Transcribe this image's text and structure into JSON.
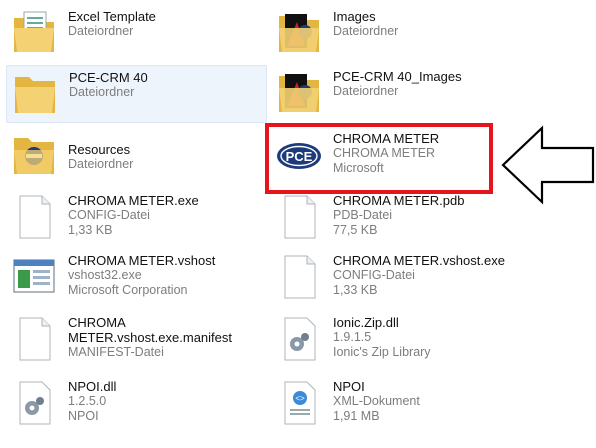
{
  "items": [
    {
      "name": "Excel Template",
      "lines": [
        "Dateiordner"
      ],
      "icon": "folder-excel-icon"
    },
    {
      "name": "Images",
      "lines": [
        "Dateiordner"
      ],
      "icon": "folder-images-icon"
    },
    {
      "name": "PCE-CRM 40",
      "lines": [
        "Dateiordner"
      ],
      "icon": "folder-icon"
    },
    {
      "name": "PCE-CRM 40_Images",
      "lines": [
        "Dateiordner"
      ],
      "icon": "folder-images-icon"
    },
    {
      "name": "Resources",
      "lines": [
        "Dateiordner"
      ],
      "icon": "folder-resources-icon"
    },
    {
      "name": "CHROMA METER",
      "lines": [
        "CHROMA METER",
        "Microsoft"
      ],
      "icon": "pce-logo-icon"
    },
    {
      "name": "CHROMA METER.exe",
      "lines": [
        "CONFIG-Datei",
        "1,33 KB"
      ],
      "icon": "document-icon"
    },
    {
      "name": "CHROMA METER.pdb",
      "lines": [
        "PDB-Datei",
        "77,5 KB"
      ],
      "icon": "document-icon"
    },
    {
      "name": "CHROMA METER.vshost",
      "lines": [
        "vshost32.exe",
        "Microsoft Corporation"
      ],
      "icon": "application-window-icon"
    },
    {
      "name": "CHROMA METER.vshost.exe",
      "lines": [
        "CONFIG-Datei",
        "1,33 KB"
      ],
      "icon": "document-icon"
    },
    {
      "name": "CHROMA",
      "name2": "METER.vshost.exe.manifest",
      "lines": [
        "MANIFEST-Datei"
      ],
      "icon": "document-icon"
    },
    {
      "name": "Ionic.Zip.dll",
      "lines": [
        "1.9.1.5",
        "Ionic's Zip Library"
      ],
      "icon": "dll-gear-icon"
    },
    {
      "name": "NPOI.dll",
      "lines": [
        "1.2.5.0",
        "NPOI"
      ],
      "icon": "dll-gear-icon"
    },
    {
      "name": "NPOI",
      "lines": [
        "XML-Dokument",
        "1,91 MB"
      ],
      "icon": "xml-document-icon"
    }
  ],
  "colors": {
    "highlight": "#e8141c",
    "selection": "#eef4fb"
  }
}
